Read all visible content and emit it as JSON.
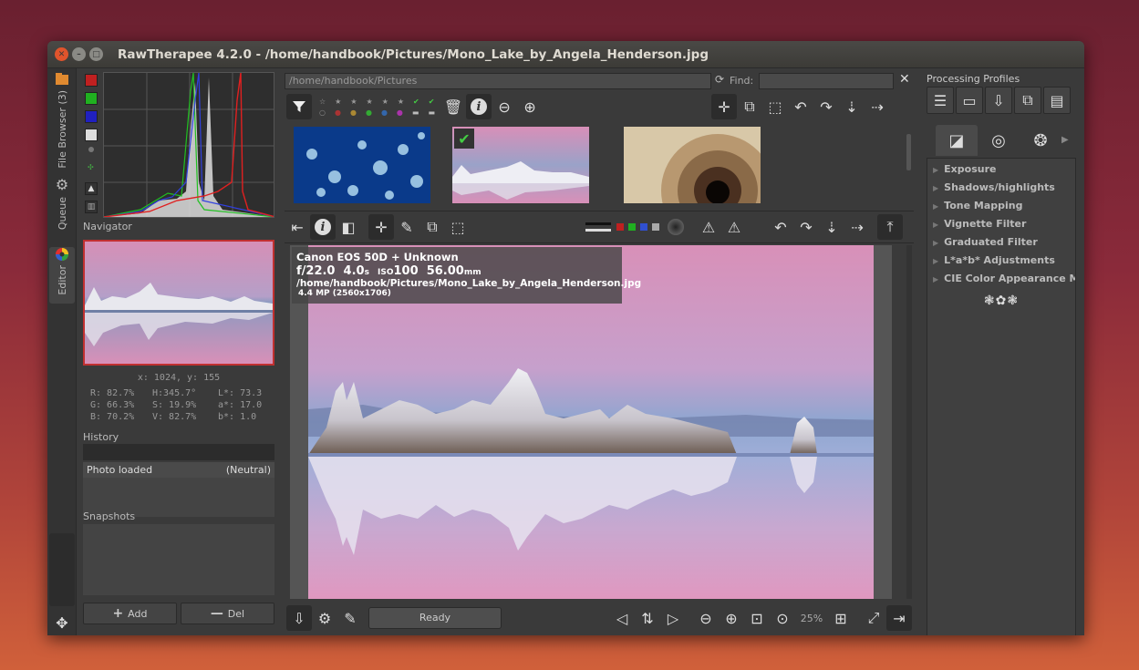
{
  "window": {
    "title": "RawTherapee 4.2.0 - /home/handbook/Pictures/Mono_Lake_by_Angela_Henderson.jpg"
  },
  "vtabs": [
    {
      "label": "File Browser (3)",
      "icon": "file-browser-icon"
    },
    {
      "label": "Queue",
      "icon": "gears-icon"
    },
    {
      "label": "Editor",
      "icon": "color-wheel-icon"
    }
  ],
  "left": {
    "navigator_title": "Navigator",
    "coords": "x: 1024, y: 155",
    "color_values": {
      "r": "R: 82.7%",
      "g": "G: 66.3%",
      "b": "B: 70.2%",
      "h": "H:345.7°",
      "s": "S: 19.9%",
      "v": "V: 82.7%",
      "l": "L*:  73.3",
      "a": "a*:  17.0",
      "bb": "b*:   1.0"
    },
    "history_title": "History",
    "history_items": [
      {
        "name": "Photo loaded",
        "value": "(Neutral)"
      }
    ],
    "snapshots_title": "Snapshots",
    "add_label": "Add",
    "del_label": "Del"
  },
  "center": {
    "path": "/home/handbook/Pictures",
    "find_label": "Find:",
    "zoom": "25%",
    "status": "Ready",
    "info": {
      "camera": "Canon EOS 50D + Unknown",
      "fnum": "f/22.0",
      "shutter": "4.0",
      "shutter_unit": "s",
      "iso_label": "ISO",
      "iso": "100",
      "focal": "56.00",
      "focal_unit": "mm",
      "file": "/home/handbook/Pictures/Mono_Lake_by_Angela_Henderson.jpg",
      "size": "4.4 MP (2560x1706)"
    }
  },
  "right": {
    "profiles_title": "Processing Profiles",
    "tools": [
      "Exposure",
      "Shadows/highlights",
      "Tone Mapping",
      "Vignette Filter",
      "Graduated Filter",
      "L*a*b* Adjustments",
      "CIE Color Appearance M"
    ]
  },
  "colors": {
    "accent_red": "#c03030",
    "panel_bg": "#3a3a3a",
    "close_btn": "#e0542c"
  }
}
